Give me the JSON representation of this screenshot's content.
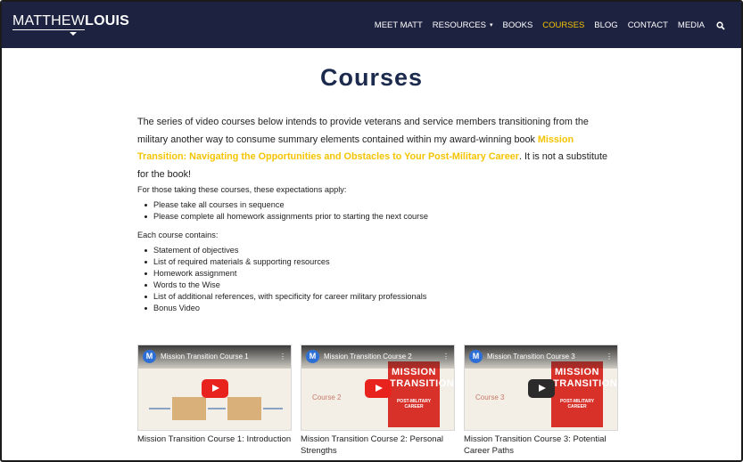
{
  "header": {
    "logo_first": "MATTHEW",
    "logo_last": "LOUIS",
    "nav": [
      {
        "label": "MEET MATT",
        "active": false
      },
      {
        "label": "RESOURCES",
        "active": false,
        "caret": "▾"
      },
      {
        "label": "BOOKS",
        "active": false
      },
      {
        "label": "COURSES",
        "active": true
      },
      {
        "label": "BLOG",
        "active": false
      },
      {
        "label": "CONTACT",
        "active": false
      },
      {
        "label": "MEDIA",
        "active": false
      }
    ],
    "bg_color": "#1c2240",
    "active_color": "#f5c400"
  },
  "page": {
    "title": "Courses",
    "intro_before": "The series of video courses below intends to provide veterans and service members transitioning from the military another way to consume summary elements contained within my award-winning book ",
    "book_title": "Mission Transition: Navigating the Opportunities and Obstacles to Your Post-Military Career",
    "intro_after": ". It is not a substitute for the book!",
    "expectations_heading": "For those taking these courses, these expectations apply:",
    "expectations": [
      "Please take all courses in sequence",
      "Please complete all homework assignments prior to starting the next course"
    ],
    "contains_heading": "Each course contains:",
    "contains": [
      "Statement of objectives",
      "List of required materials & supporting resources",
      "Homework assignment",
      "Words to the Wise",
      "List of additional references, with specificity for career military professionals",
      "Bonus Video"
    ]
  },
  "videos": [
    {
      "thumb_title": "Mission Transition Course 1",
      "caption": "Mission Transition Course 1: Introduction",
      "channel": "M"
    },
    {
      "thumb_title": "Mission Transition Course 2",
      "caption": "Mission Transition Course 2: Personal Strengths",
      "channel": "M",
      "course_label": "Course 2",
      "book_word1": "MISSION",
      "book_word2": "TRANSITION",
      "book_word3": "POST-MILITARY CAREER"
    },
    {
      "thumb_title": "Mission Transition Course 3",
      "caption": "Mission Transition Course 3: Potential Career Paths",
      "channel": "M",
      "course_label": "Course 3",
      "book_word1": "MISSION",
      "book_word2": "TRANSITION",
      "book_word3": "POST-MILITARY CAREER"
    }
  ]
}
